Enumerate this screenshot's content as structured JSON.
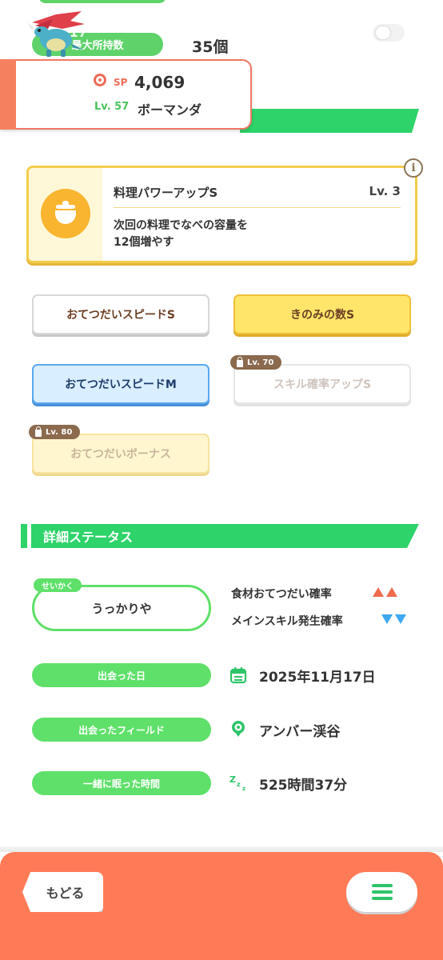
{
  "header": {
    "max_holding_label": "最大所持数",
    "max_holding_overlap": "23:17",
    "max_holding_value": "35個"
  },
  "pokemon": {
    "name": "ボーマンダ",
    "sp_label": "SP",
    "sp_value": "4,069",
    "level_label": "Lv. 57"
  },
  "main_skill": {
    "title": "料理パワーアップS",
    "level": "Lv. 3",
    "description": "次回の料理でなべの容量を\n12個増やす",
    "info_icon": "i"
  },
  "sub_skills": [
    {
      "label": "おてつだいスピードS"
    },
    {
      "label": "きのみの数S"
    },
    {
      "label": "おてつだいスピードM"
    },
    {
      "label": "スキル確率アップS",
      "lock_level": "Lv. 70"
    },
    {
      "label": "おてつだいボーナス",
      "lock_level": "Lv. 80"
    }
  ],
  "details": {
    "section_title": "詳細ステータス",
    "nature_tag": "せいかく",
    "nature": "うっかりや",
    "nature_up": "食材おてつだい確率",
    "nature_down": "メインスキル発生確率",
    "met_date_label": "出会った日",
    "met_date": "2025年11月17日",
    "met_field_label": "出会ったフィールド",
    "met_field": "アンバー渓谷",
    "sleep_time_label": "一緒に眠った時間",
    "sleep_time": "525時間37分"
  },
  "bottom": {
    "back_label": "もどる"
  },
  "colors": {
    "green": "#2ed36a",
    "light_green": "#5fe06a",
    "orange": "#ff7a57",
    "up_red": "#f06b4d",
    "down_blue": "#3ea8f0"
  },
  "icons": [
    "sp-icon",
    "pot-icon",
    "info-icon",
    "lock-icon",
    "calendar-icon",
    "field-pin-icon",
    "sleep-zzz-icon",
    "menu-icon"
  ]
}
